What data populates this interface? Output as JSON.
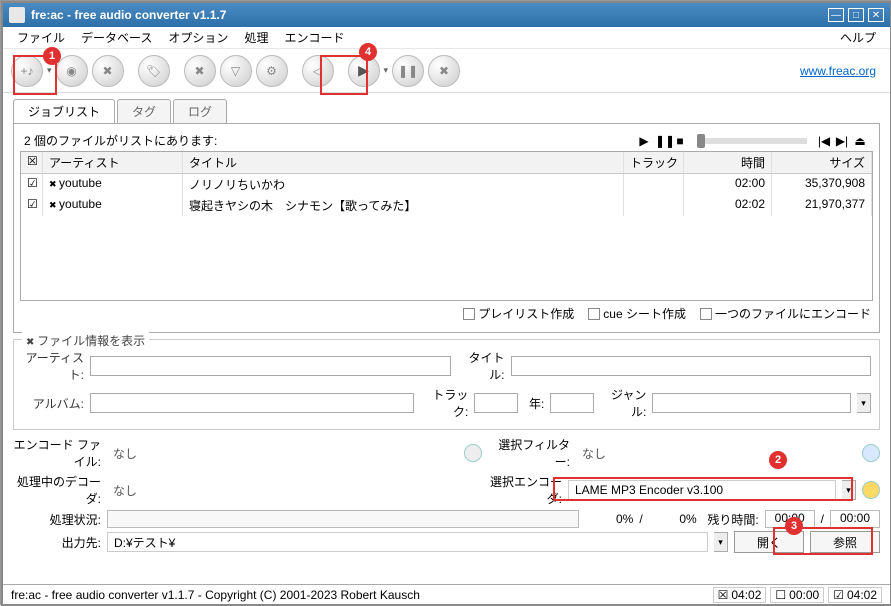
{
  "window": {
    "title": "fre:ac - free audio converter v1.1.7"
  },
  "menu": {
    "file": "ファイル",
    "database": "データベース",
    "options": "オプション",
    "process": "処理",
    "encode": "エンコード",
    "help": "ヘルプ"
  },
  "toolbar_link": "www.freac.org",
  "tabs": {
    "joblist": "ジョブリスト",
    "tag": "タグ",
    "log": "ログ"
  },
  "list": {
    "summary": "2 個のファイルがリストにあります:",
    "headers": {
      "artist": "アーティスト",
      "title": "タイトル",
      "track": "トラック",
      "time": "時間",
      "size": "サイズ"
    },
    "rows": [
      {
        "artist": "youtube",
        "title": "ノリノリちいかわ",
        "track": "",
        "time": "02:00",
        "size": "35,370,908"
      },
      {
        "artist": "youtube",
        "title": "寝起きヤシの木　シナモン【歌ってみた】",
        "track": "",
        "time": "02:02",
        "size": "21,970,377"
      }
    ]
  },
  "opts": {
    "playlist": "プレイリスト作成",
    "cue": "cue シート作成",
    "onefile": "一つのファイルにエンコード"
  },
  "fileinfo": {
    "legend": "ファイル情報を表示",
    "artist": "アーティスト:",
    "title": "タイトル:",
    "album": "アルバム:",
    "track": "トラック:",
    "year": "年:",
    "genre": "ジャンル:"
  },
  "enc": {
    "encfile_lbl": "エンコード ファイル:",
    "encfile_val": "なし",
    "filter_lbl": "選択フィルター:",
    "filter_val": "なし",
    "decoder_lbl": "処理中のデコーダ:",
    "decoder_val": "なし",
    "encoder_lbl": "選択エンコーダ:",
    "encoder_val": "LAME MP3 Encoder v3.100",
    "progress_lbl": "処理状況:",
    "pct1": "0%",
    "pct2": "0%",
    "remain_lbl": "残り時間:",
    "t1": "00:00",
    "t2": "00:00",
    "out_lbl": "出力先:",
    "out_val": "D:¥テスト¥",
    "open": "開く",
    "browse": "参照"
  },
  "status": {
    "text": "fre:ac - free audio converter v1.1.7 - Copyright (C) 2001-2023 Robert Kausch",
    "t_a": "04:02",
    "t_b": "00:00",
    "t_c": "04:02"
  },
  "callouts": {
    "c1": "1",
    "c2": "2",
    "c3": "3",
    "c4": "4"
  }
}
